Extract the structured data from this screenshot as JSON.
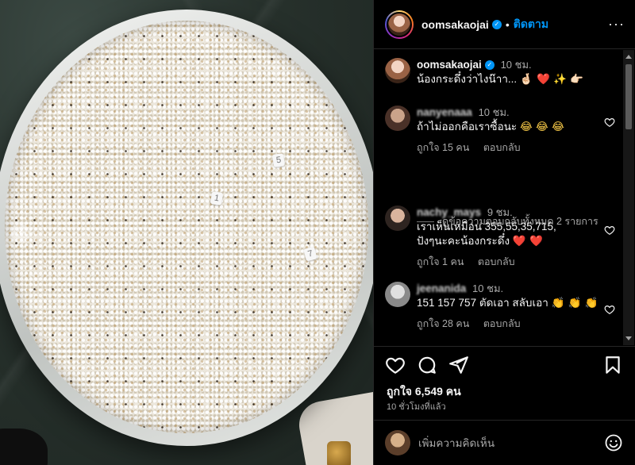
{
  "post": {
    "username": "oomsakaojai",
    "follow_label": "ติดตาม",
    "separator": "•",
    "more_label": "···",
    "caption_time": "10 ชม.",
    "caption_text": "น้องกระดึ๋งว่าไงน๊าา...",
    "caption_emoji": "🤞🏻 ❤️ ✨ 👉🏻",
    "image_tags": [
      "5",
      "1",
      "7"
    ],
    "image_carousel_icon": "chevron-left-icon"
  },
  "comments": [
    {
      "user": "nanyenaaa",
      "time": "10 ชม.",
      "text": "ถ้าไม่ออกคือเราซื้อนะ",
      "emoji": "😂 😂 😂",
      "likes": "ถูกใจ 15 คน",
      "reply": "ตอบกลับ",
      "view_replies": "ดูข้อความตอบกลับทั้งหมด 2 รายการ"
    },
    {
      "user": "nachy_mays",
      "time": "9 ชม.",
      "text": "เราเห็นเหมือน 355,55,35,715,\nปังๆนะคะน้องกระดึ๋ง",
      "emoji": "❤️ ❤️",
      "likes": "ถูกใจ 1 คน",
      "reply": "ตอบกลับ"
    },
    {
      "user": "jeenanida",
      "time": "10 ชม.",
      "text": "151 157 757 ตัดเอา สลับเอา",
      "emoji": "👏 👏 👏",
      "likes": "ถูกใจ 28 คน",
      "reply": "ตอบกลับ"
    }
  ],
  "actions": {
    "likes_text": "ถูกใจ 6,549 คน",
    "time_ago": "10 ชั่วโมงที่แล้ว",
    "comment_placeholder": "เพิ่มความคิดเห็น"
  },
  "colors": {
    "accent": "#0095f6",
    "background": "#000000",
    "text": "#f5f5f5",
    "muted": "#a8a8a8",
    "heart": "#e0245e"
  },
  "icons": [
    "heart-icon",
    "comment-icon",
    "share-icon",
    "bookmark-icon",
    "emoji-icon",
    "verified-icon",
    "more-icon"
  ]
}
